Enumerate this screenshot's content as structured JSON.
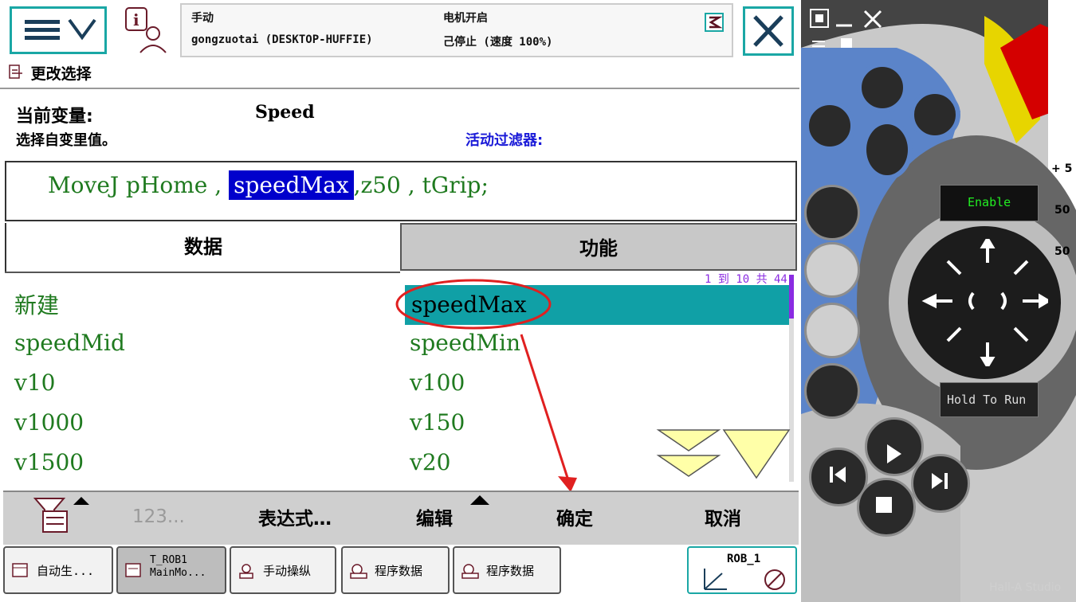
{
  "header": {
    "mode": "手动",
    "station": "gongzuotai (DESKTOP-HUFFIE)",
    "motor": "电机开启",
    "state": "己停止 (速度 100%)",
    "subtitle": "更改选择"
  },
  "variable": {
    "current_label": "当前变量:",
    "current_value": "Speed",
    "hint": "选择自变里值。",
    "filter_label": "活动过滤器:"
  },
  "instruction": {
    "pre": "MoveJ pHome ,",
    "selected": "speedMax",
    "post": ",z50 , tGrip;"
  },
  "tabs": {
    "data": "数据",
    "function": "功能"
  },
  "list": {
    "page_info": "1 到 10 共 44",
    "left": [
      "新建",
      "speedMid",
      "v10",
      "v1000",
      "v1500"
    ],
    "right": [
      "speedMax",
      "speedMin",
      "v100",
      "v150",
      "v20"
    ]
  },
  "toolbar": {
    "numeric": "123...",
    "expression": "表达式…",
    "edit": "编辑",
    "ok": "确定",
    "cancel": "取消"
  },
  "taskbar": {
    "items": [
      "自动生...",
      "T_ROB1\nMainMo...",
      "手动操纵",
      "程序数据",
      "程序数据"
    ],
    "robot": "ROB_1"
  },
  "jog": {
    "enable": "Enable",
    "hold": "Hold To Run",
    "partial": [
      "+ 5",
      "50",
      "50"
    ]
  },
  "watermark": "Hall-A Studio",
  "colors": {
    "accent": "#1aa7a5",
    "selection": "#10a0a6",
    "highlight": "#0000cc",
    "text_green": "#1f7a1f",
    "annotation": "#e02020"
  }
}
